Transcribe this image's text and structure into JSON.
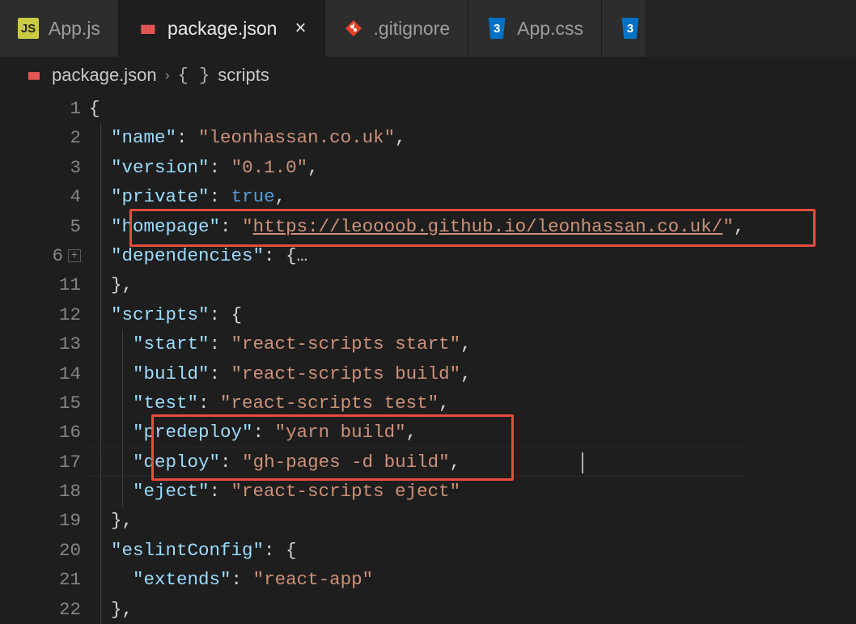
{
  "tabs": [
    {
      "icon": "js",
      "label": "App.js",
      "active": false
    },
    {
      "icon": "npm",
      "label": "package.json",
      "active": true
    },
    {
      "icon": "git",
      "label": ".gitignore",
      "active": false
    },
    {
      "icon": "css",
      "label": "App.css",
      "active": false
    },
    {
      "icon": "css",
      "label": "",
      "active": false,
      "truncated": true
    }
  ],
  "breadcrumb": {
    "icon": "npm",
    "file": "package.json",
    "symbol_kind": "{ }",
    "symbol": "scripts"
  },
  "gutter_lines": [
    "1",
    "2",
    "3",
    "4",
    "5",
    "6",
    "11",
    "12",
    "13",
    "14",
    "15",
    "16",
    "17",
    "18",
    "19",
    "20",
    "21",
    "22"
  ],
  "fold_line_index": 5,
  "json": {
    "name": "leonhassan.co.uk",
    "version": "0.1.0",
    "private": true,
    "homepage": "https://leoooob.github.io/leonhassan.co.uk/",
    "dependencies_collapsed": "…",
    "scripts": {
      "start": "react-scripts start",
      "build": "react-scripts build",
      "test": "react-scripts test",
      "predeploy": "yarn build",
      "deploy": "gh-pages -d build",
      "eject": "react-scripts eject"
    },
    "eslintConfig": {
      "extends": "react-app"
    }
  },
  "highlight_boxes": [
    {
      "top_row": 4,
      "left_ch": 4,
      "width_ch": 62,
      "height_rows": 1.25
    },
    {
      "top_row": 11,
      "left_ch": 6,
      "width_ch": 32.5,
      "height_rows": 2.18
    }
  ],
  "cursor": {
    "row": 12,
    "ch": 45
  },
  "colors": {
    "string": "#ce9178",
    "property": "#9cdcfe",
    "bool": "#569cd6",
    "punct": "#d4d4d4",
    "highlight_border": "#e74c3c"
  }
}
